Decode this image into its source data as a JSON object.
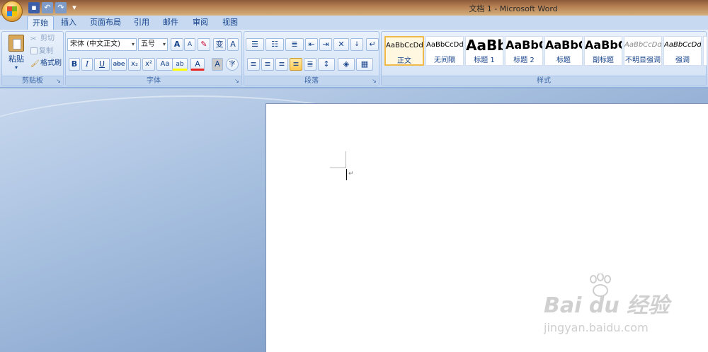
{
  "window": {
    "title": "文档 1 - Microsoft Word"
  },
  "quick_access": [
    "save",
    "undo",
    "redo",
    "customize"
  ],
  "tabs": [
    {
      "label": "开始",
      "active": true
    },
    {
      "label": "插入"
    },
    {
      "label": "页面布局"
    },
    {
      "label": "引用"
    },
    {
      "label": "邮件"
    },
    {
      "label": "审阅"
    },
    {
      "label": "视图"
    }
  ],
  "clipboard": {
    "group_label": "剪贴板",
    "paste": "粘贴",
    "cut": "剪切",
    "copy": "复制",
    "format_painter": "格式刷"
  },
  "font": {
    "group_label": "字体",
    "font_name": "宋体 (中文正文)",
    "font_size": "五号",
    "grow": "A",
    "shrink": "A",
    "bold": "B",
    "italic": "I",
    "underline": "U",
    "strike": "abe",
    "subscript": "x₂",
    "superscript": "x²",
    "change_case": "Aa",
    "font_color": "A",
    "char_shade": "A",
    "enclose": "字",
    "phonetic": "变",
    "char_border": "A"
  },
  "paragraph": {
    "group_label": "段落"
  },
  "styles": {
    "group_label": "样式",
    "items": [
      {
        "sample": "AaBbCcDd",
        "name": "正文",
        "selected": true
      },
      {
        "sample": "AaBbCcDd",
        "name": "无间隔"
      },
      {
        "sample": "AaBb",
        "name": "标题 1"
      },
      {
        "sample": "AaBbC",
        "name": "标题 2"
      },
      {
        "sample": "AaBbC",
        "name": "标题"
      },
      {
        "sample": "AaBbC",
        "name": "副标题"
      },
      {
        "sample": "AaBbCcDd",
        "name": "不明显强调"
      },
      {
        "sample": "AaBbCcDd",
        "name": "强调"
      }
    ]
  },
  "document": {
    "paragraph_mark": "↵"
  },
  "watermark": {
    "main": "Bai du 经验",
    "sub": "jingyan.baidu.com"
  },
  "colors": {
    "font_color_bar": "#e8261f",
    "highlight_bar": "#ffff00",
    "accent": "#15428b"
  }
}
